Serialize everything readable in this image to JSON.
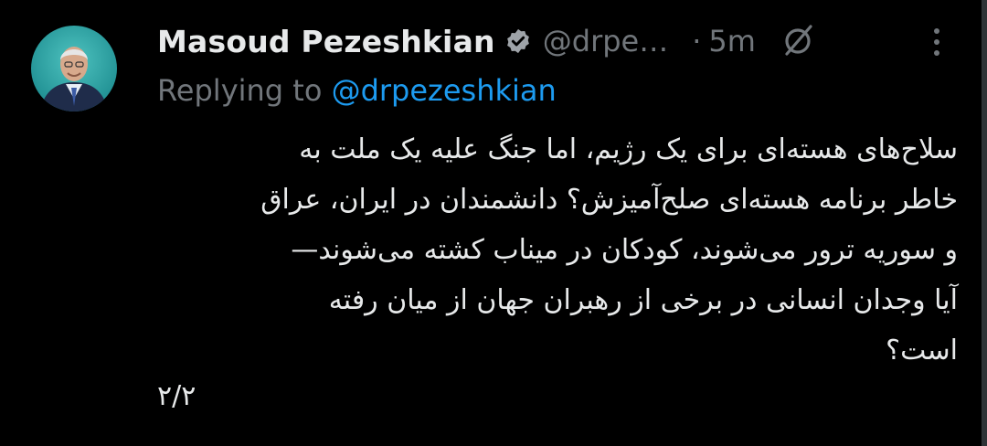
{
  "author": {
    "display_name": "Masoud Pezeshkian",
    "handle": "@drpe…",
    "verified_icon": "verified-badge-icon",
    "avatar_icon": "avatar"
  },
  "meta": {
    "separator": "·",
    "time": "5m"
  },
  "replying": {
    "prefix": "Replying to",
    "mention": "@drpezeshkian"
  },
  "tweet": {
    "lines": [
      "سلاح‌های هسته‌ای برای یک رژیم، اما جنگ علیه یک ملت به",
      "خاطر برنامه هسته‌ای صلح‌آمیزش؟ دانشمندان در ایران، عراق",
      "و سوریه ترور می‌شوند، کودکان در میناب کشته می‌شوند—",
      "آیا وجدان انسانی در برخی از رهبران جهان از میان رفته",
      "است؟"
    ],
    "thread_count": "۲/۲"
  },
  "colors": {
    "background": "#000000",
    "text": "#e7e9ea",
    "secondary": "#71767b",
    "accent": "#1d9bf0"
  },
  "icons": {
    "grok": "grok-icon",
    "more": "more-icon"
  }
}
